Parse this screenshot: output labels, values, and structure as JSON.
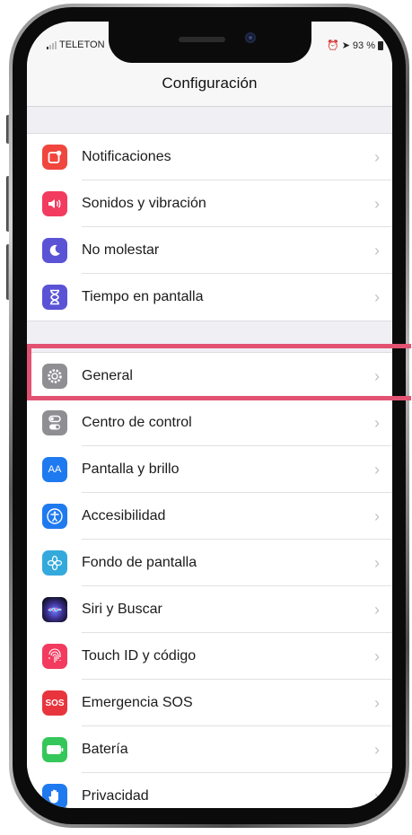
{
  "status_bar": {
    "carrier": "TELETON",
    "battery_percent": "93 %"
  },
  "nav": {
    "title": "Configuración"
  },
  "groups": [
    {
      "items": [
        {
          "label": "Notificaciones",
          "icon": "notifications-icon",
          "color": "#f0463e"
        },
        {
          "label": "Sonidos y vibración",
          "icon": "sounds-icon",
          "color": "#f23b5f"
        },
        {
          "label": "No molestar",
          "icon": "moon-icon",
          "color": "#5a53d6"
        },
        {
          "label": "Tiempo en pantalla",
          "icon": "hourglass-icon",
          "color": "#5a53d6"
        }
      ]
    },
    {
      "items": [
        {
          "label": "General",
          "icon": "gear-icon",
          "color": "#8e8e93"
        },
        {
          "label": "Centro de control",
          "icon": "control-center-icon",
          "color": "#8e8e93"
        },
        {
          "label": "Pantalla y brillo",
          "icon": "display-brightness-icon",
          "color": "#1f7af0",
          "glyph": "AA"
        },
        {
          "label": "Accesibilidad",
          "icon": "accessibility-icon",
          "color": "#1f7af0"
        },
        {
          "label": "Fondo de pantalla",
          "icon": "wallpaper-icon",
          "color": "#34aadc"
        },
        {
          "label": "Siri y Buscar",
          "icon": "siri-icon",
          "color": "#1c1c3a"
        },
        {
          "label": "Touch ID y código",
          "icon": "fingerprint-icon",
          "color": "#f23b5f"
        },
        {
          "label": "Emergencia SOS",
          "icon": "sos-icon",
          "color": "#e8353d",
          "glyph": "SOS"
        },
        {
          "label": "Batería",
          "icon": "battery-icon",
          "color": "#35c759"
        },
        {
          "label": "Privacidad",
          "icon": "hand-icon",
          "color": "#1f7af0"
        }
      ]
    }
  ],
  "highlight": {
    "target": "General",
    "color": "#e25271"
  }
}
